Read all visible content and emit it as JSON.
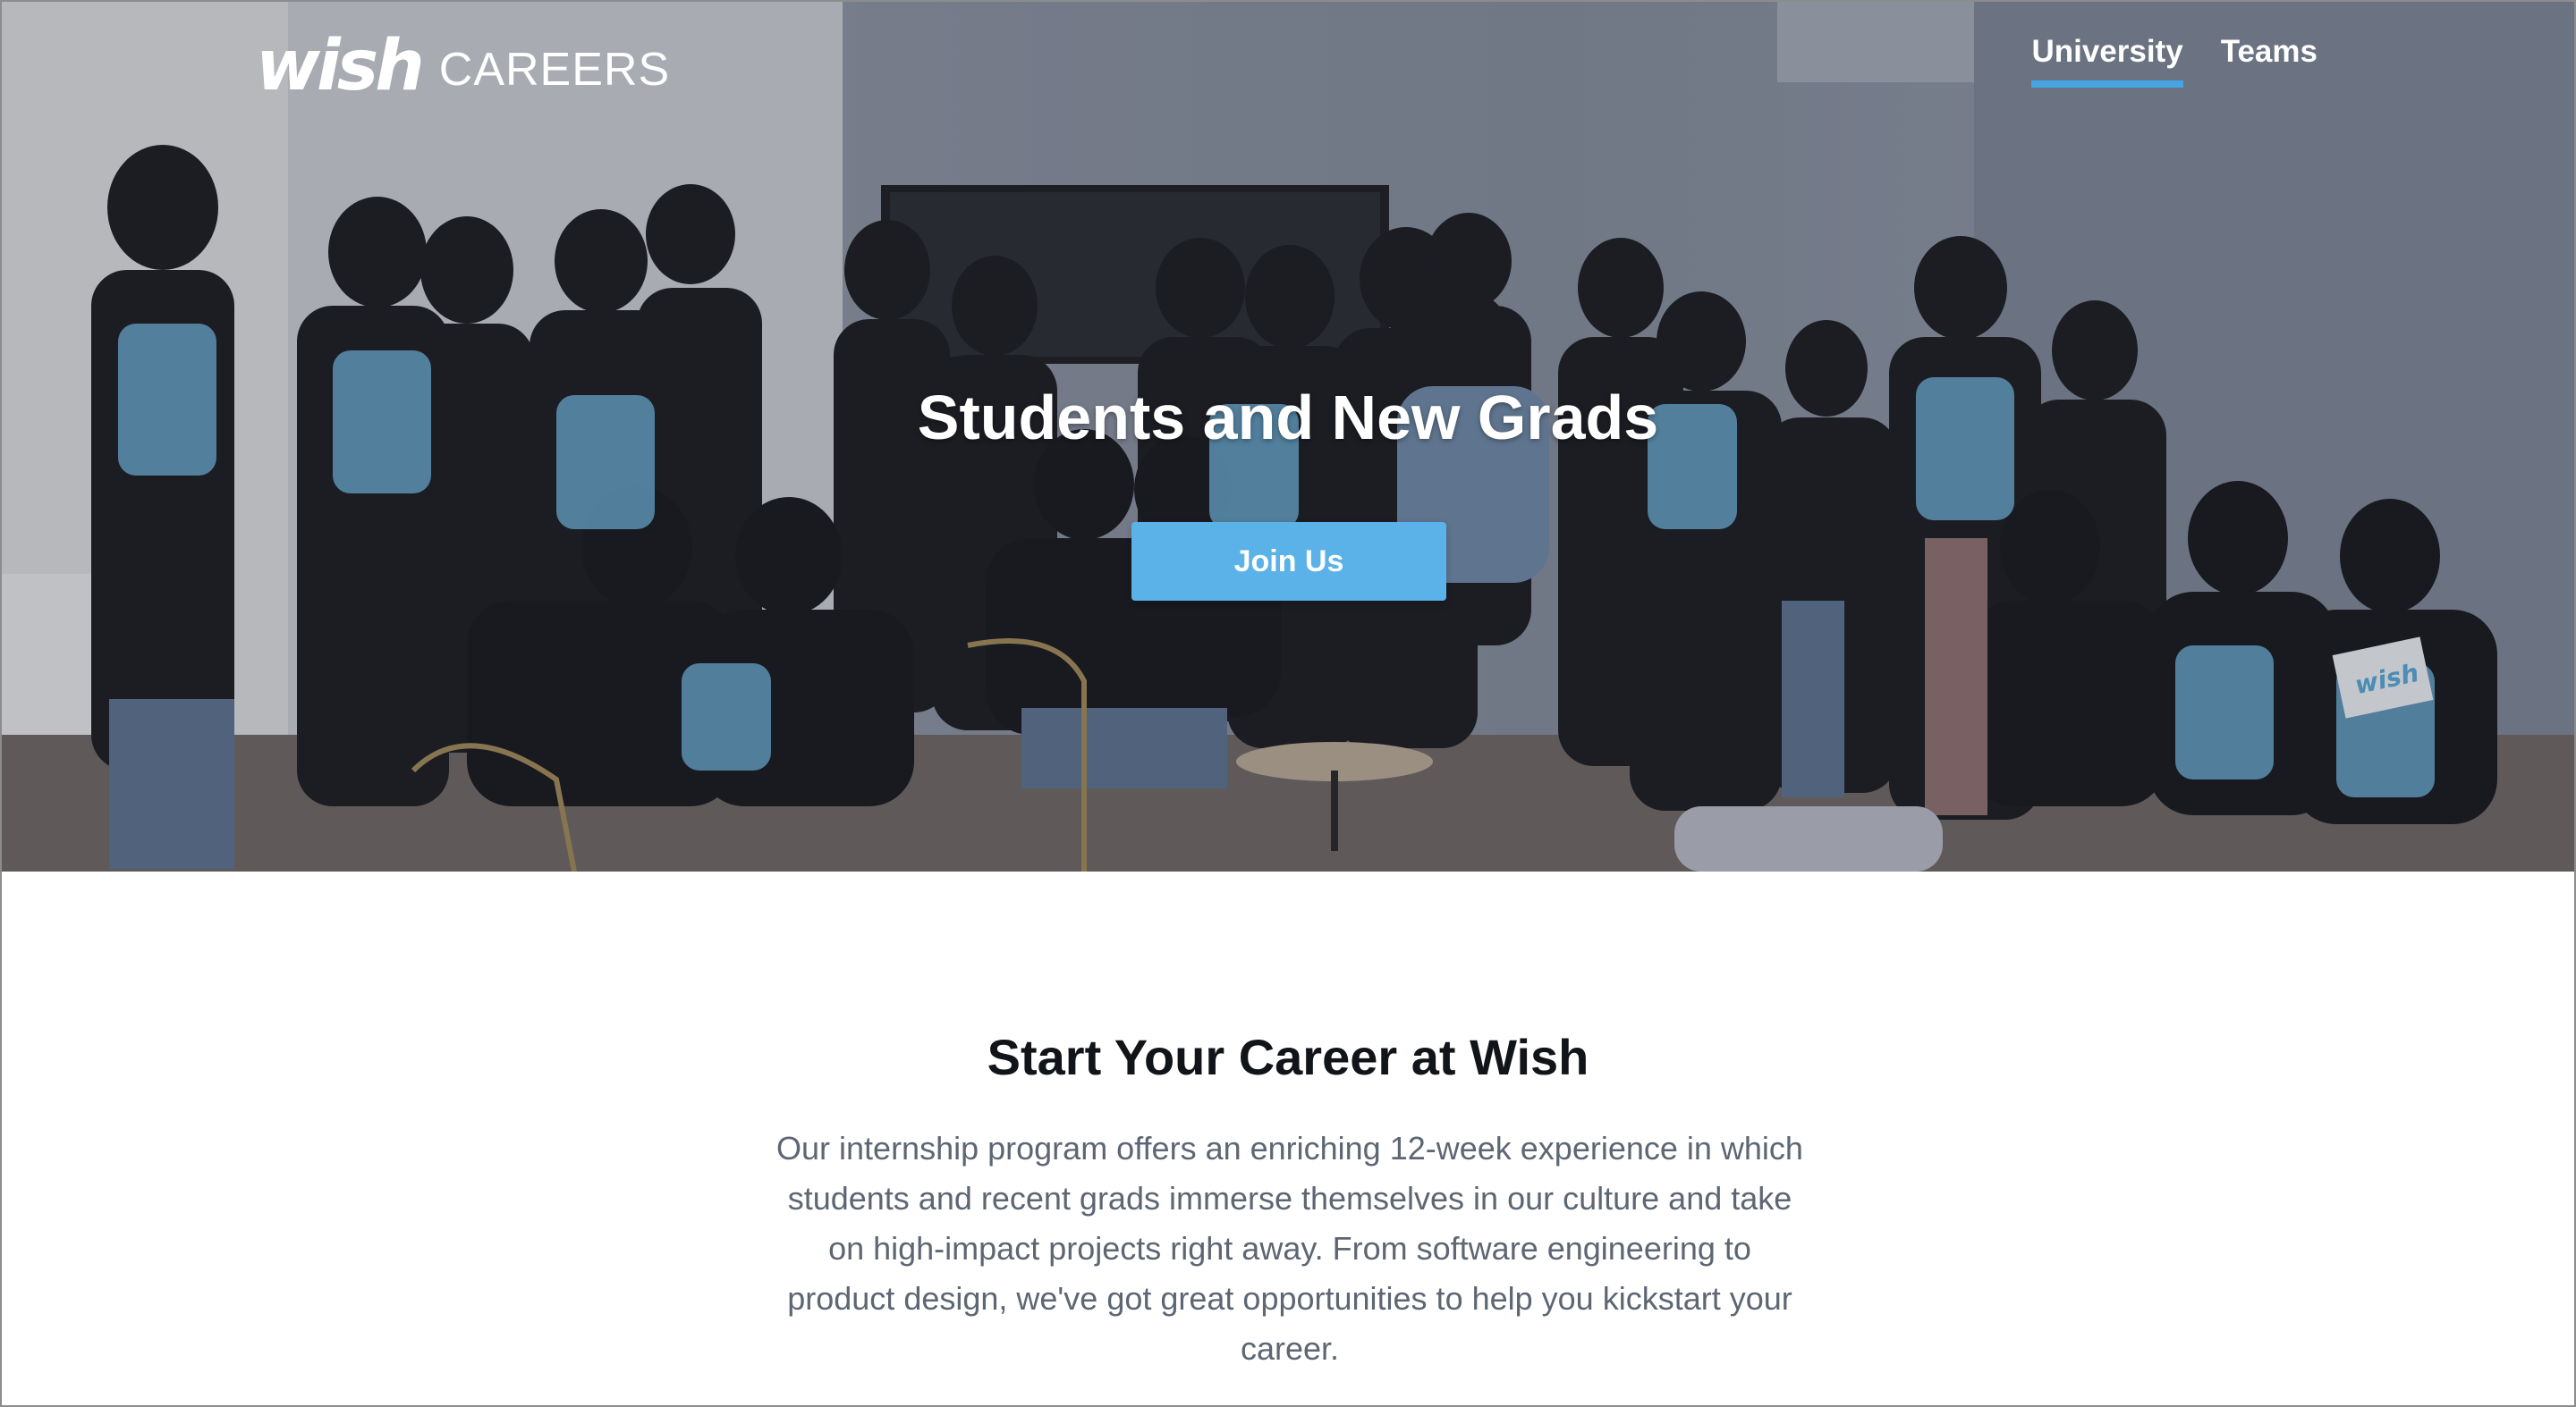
{
  "header": {
    "logo_mark": "wish",
    "logo_sub": "CAREERS",
    "nav": [
      {
        "label": "University",
        "active": true
      },
      {
        "label": "Teams",
        "active": false
      }
    ],
    "accent_color": "#45a4e3"
  },
  "hero": {
    "image_description": "group photo of Wish interns in black t-shirts",
    "title": "Students and New Grads",
    "cta_label": "Join Us",
    "cta_color": "#5ab2e8",
    "card_logo": "wish"
  },
  "intro": {
    "title": "Start Your Career at Wish",
    "body": "Our internship program offers an enriching 12-week experience in which students and recent grads immerse themselves in our culture and take on high-impact projects right away. From software engineering to product design, we've got great opportunities to help you kickstart your career."
  }
}
